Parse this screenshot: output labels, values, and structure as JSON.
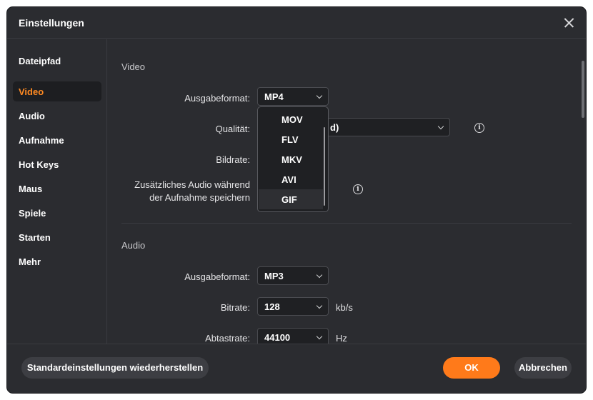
{
  "window": {
    "title": "Einstellungen"
  },
  "sidebar": {
    "items": [
      {
        "label": "Dateipfad"
      },
      {
        "label": "Video",
        "active": true
      },
      {
        "label": "Audio"
      },
      {
        "label": "Aufnahme"
      },
      {
        "label": "Hot Keys"
      },
      {
        "label": "Maus"
      },
      {
        "label": "Spiele"
      },
      {
        "label": "Starten"
      },
      {
        "label": "Mehr"
      }
    ]
  },
  "video": {
    "section_title": "Video",
    "output_format_label": "Ausgabeformat:",
    "output_format_value": "MP4",
    "quality_label": "Qualität:",
    "quality_value_visible": "d)",
    "framerate_label": "Bildrate:",
    "extra_audio_label_line1": "Zusätzliches Audio während",
    "extra_audio_label_line2": "der Aufnahme speichern",
    "format_dropdown_options": [
      "MOV",
      "FLV",
      "MKV",
      "AVI",
      "GIF"
    ],
    "hovered_option": "GIF"
  },
  "audio": {
    "section_title": "Audio",
    "output_format_label": "Ausgabeformat:",
    "output_format_value": "MP3",
    "bitrate_label": "Bitrate:",
    "bitrate_value": "128",
    "bitrate_unit": "kb/s",
    "samplerate_label": "Abtastrate:",
    "samplerate_value": "44100",
    "samplerate_unit": "Hz"
  },
  "footer": {
    "reset_label": "Standardeinstellungen wiederherstellen",
    "ok_label": "OK",
    "cancel_label": "Abbrechen"
  },
  "colors": {
    "accent": "#ff7a1a",
    "background": "#2b2c30",
    "active_nav_text": "#ff8a22"
  },
  "icons": {
    "close": "close-icon",
    "info": "info-icon",
    "chevron": "chevron-down-icon"
  }
}
